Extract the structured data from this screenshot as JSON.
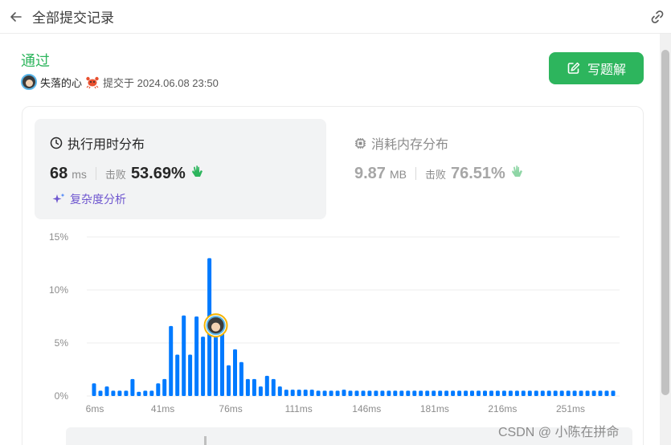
{
  "topbar": {
    "title": "全部提交记录"
  },
  "submission": {
    "status": "通过",
    "username": "失落的心",
    "submitted_text": "提交于 2024.06.08 23:50"
  },
  "actions": {
    "write_solution": "写题解"
  },
  "runtime": {
    "title": "执行用时分布",
    "value": "68",
    "unit": "ms",
    "beat_label": "击败",
    "beat_pct": "53.69%"
  },
  "memory": {
    "title": "消耗内存分布",
    "value": "9.87",
    "unit": "MB",
    "beat_label": "击败",
    "beat_pct": "76.51%"
  },
  "complexity_link": "复杂度分析",
  "watermark": "CSDN @ 小陈在拼命",
  "colors": {
    "accent": "#2db55d",
    "bar": "#007aff",
    "purple": "#6e56cf"
  },
  "chart_data": {
    "type": "bar",
    "ylim": [
      0,
      15
    ],
    "y_ticks": [
      "15%",
      "10%",
      "5%",
      "0%"
    ],
    "x_ticks": [
      "6ms",
      "41ms",
      "76ms",
      "111ms",
      "146ms",
      "181ms",
      "216ms",
      "251ms"
    ],
    "ylabel": "",
    "xlabel": "",
    "highlight_index": 19,
    "values": [
      1.2,
      0.5,
      0.9,
      0.5,
      0.5,
      0.5,
      1.6,
      0.4,
      0.5,
      0.5,
      1.2,
      1.6,
      6.6,
      3.9,
      7.6,
      3.9,
      7.5,
      5.6,
      13.0,
      5.6,
      6.0,
      2.9,
      4.4,
      3.2,
      1.6,
      1.6,
      0.9,
      1.9,
      1.6,
      0.9,
      0.6,
      0.6,
      0.6,
      0.6,
      0.6,
      0.5,
      0.5,
      0.5,
      0.5,
      0.6,
      0.5,
      0.5,
      0.5,
      0.5,
      0.5,
      0.5,
      0.5,
      0.5,
      0.5,
      0.5,
      0.5,
      0.5,
      0.5,
      0.5,
      0.5,
      0.5,
      0.5,
      0.5,
      0.5,
      0.5,
      0.5,
      0.5,
      0.5,
      0.5,
      0.5,
      0.5,
      0.5,
      0.5,
      0.5,
      0.5,
      0.5,
      0.5,
      0.5,
      0.5,
      0.5,
      0.5,
      0.5,
      0.5,
      0.5,
      0.5,
      0.5,
      0.5
    ]
  }
}
